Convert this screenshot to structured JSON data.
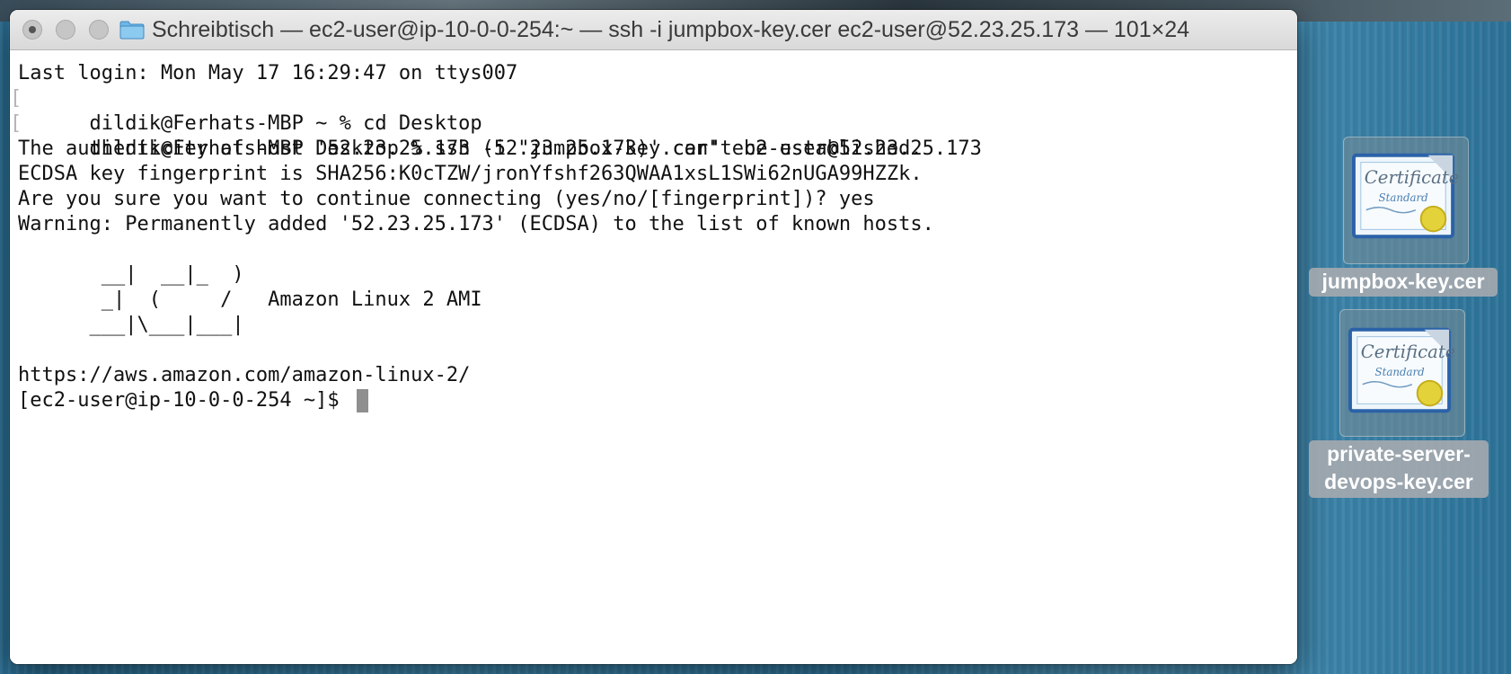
{
  "window": {
    "title": "Schreibtisch — ec2-user@ip-10-0-0-254:~ — ssh -i jumpbox-key.cer ec2-user@52.23.25.173 — 101×24",
    "buttons": [
      "close",
      "minimize",
      "zoom"
    ]
  },
  "terminal": {
    "lines": [
      "Last login: Mon May 17 16:29:47 on ttys007",
      "dildik@Ferhats-MBP ~ % cd Desktop",
      "dildik@Ferhats-MBP Desktop % ssh -i \"jumpbox-key.cer\" ec2-user@52.23.25.173",
      "The authenticity of host '52.23.25.173 (52.23.25.173)' can't be established.",
      "ECDSA key fingerprint is SHA256:K0cTZW/jronYfshf263QWAA1xsL1SWi62nUGA99HZZk.",
      "Are you sure you want to continue connecting (yes/no/[fingerprint])? yes",
      "Warning: Permanently added '52.23.25.173' (ECDSA) to the list of known hosts.",
      "",
      "       __|  __|_  )",
      "       _|  (     /   Amazon Linux 2 AMI",
      "      ___|\\___|___|",
      "",
      "https://aws.amazon.com/amazon-linux-2/",
      "[ec2-user@ip-10-0-0-254 ~]$ "
    ],
    "prompt_mark_left": "[",
    "prompt_mark_right": "]"
  },
  "desktop": {
    "icons": [
      {
        "label": "jumpbox-key.cer",
        "icon": "certificate-icon"
      },
      {
        "label_line1": "private-server-",
        "label_line2": "devops-key.cer",
        "icon": "certificate-icon"
      }
    ]
  },
  "colors": {
    "desktop": "#2f7aa3",
    "titlebar": "#dcdcdc",
    "terminal_bg": "#ffffff",
    "terminal_text": "#111111",
    "cursor": "#8f8f8f"
  }
}
